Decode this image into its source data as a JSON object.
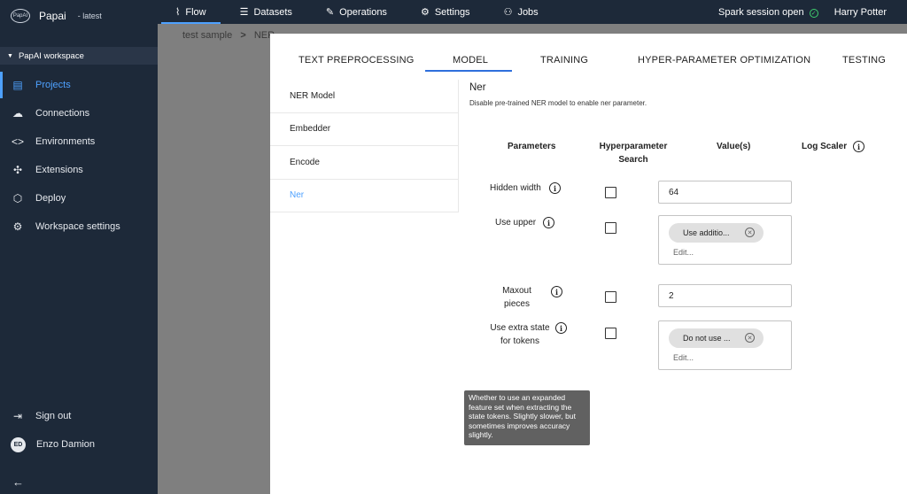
{
  "app": {
    "name": "Papai",
    "version": "- latest",
    "logo_text": "PapAI"
  },
  "workspace": {
    "label": "PapAI workspace"
  },
  "sidebar": {
    "items": [
      {
        "label": "Projects",
        "icon": "projects-icon",
        "active": true
      },
      {
        "label": "Connections",
        "icon": "cloud-icon"
      },
      {
        "label": "Environments",
        "icon": "code-icon"
      },
      {
        "label": "Extensions",
        "icon": "puzzle-icon"
      },
      {
        "label": "Deploy",
        "icon": "cube-icon"
      },
      {
        "label": "Workspace settings",
        "icon": "gear-icon"
      }
    ],
    "sign_out": "Sign out",
    "user": {
      "name": "Enzo Damion",
      "initials": "ED"
    }
  },
  "topnav": {
    "tabs": [
      {
        "label": "Flow",
        "icon": "flow-icon",
        "active": true
      },
      {
        "label": "Datasets",
        "icon": "list-icon"
      },
      {
        "label": "Operations",
        "icon": "wrench-icon"
      },
      {
        "label": "Settings",
        "icon": "gear-icon"
      },
      {
        "label": "Jobs",
        "icon": "jobs-icon"
      }
    ],
    "spark_status": "Spark session open",
    "user": "Harry Potter"
  },
  "breadcrumb": {
    "project": "test sample",
    "separator": ">",
    "current": "NER"
  },
  "panel": {
    "tabs": [
      "TEXT PREPROCESSING",
      "MODEL",
      "TRAINING",
      "HYPER-PARAMETER OPTIMIZATION",
      "TESTING"
    ],
    "active_tab": "MODEL",
    "menu": [
      "NER Model",
      "Embedder",
      "Encode",
      "Ner"
    ],
    "active_menu": "Ner",
    "title": "Ner",
    "description": "Disable pre-trained NER model to enable ner parameter.",
    "columns": {
      "parameters": "Parameters",
      "hyper_line1": "Hyperparameter",
      "hyper_line2": "Search",
      "values": "Value(s)",
      "log_scaler": "Log Scaler"
    },
    "rows": {
      "hidden_width": {
        "label": "Hidden width",
        "value": "64"
      },
      "use_upper": {
        "label": "Use upper",
        "chip": "Use additio...",
        "edit_placeholder": "Edit..."
      },
      "maxout_pieces": {
        "label_line1": "Maxout",
        "label_line2": "pieces",
        "value": "2"
      },
      "extra_state": {
        "label_line1": "Use extra state",
        "label_line2": "for tokens",
        "chip": "Do not use ...",
        "edit_placeholder": "Edit..."
      }
    },
    "tooltip": "Whether to use an expanded feature set when extracting the state tokens. Slightly slower, but sometimes improves accuracy slightly."
  },
  "colors": {
    "sidebar_bg": "#1d2939",
    "accent": "#4ea1ff",
    "status_ok": "#3fcf6e",
    "tab_underline": "#2f6fdc"
  }
}
